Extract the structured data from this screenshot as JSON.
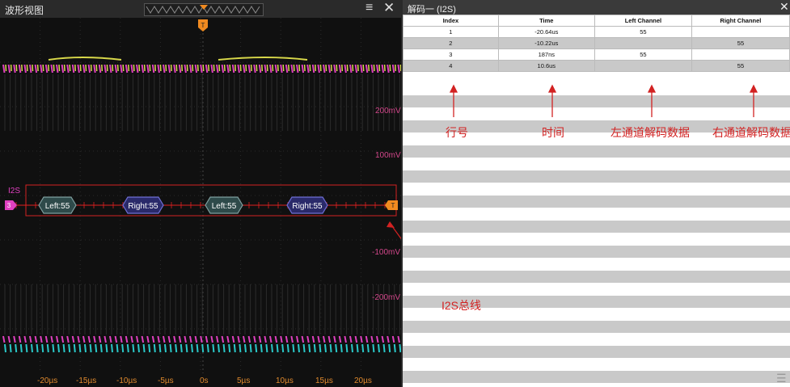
{
  "waveform": {
    "title": "波形视图",
    "trigger_marker": "T",
    "bus_label": "I2S",
    "channel_marker": "3",
    "bus_end_marker": "T",
    "packets": [
      "Left:55",
      "Right:55",
      "Left:55",
      "Right:55"
    ],
    "y_labels": [
      "200mV",
      "100mV",
      "-100mV",
      "-200mV"
    ],
    "x_labels": [
      "-20µs",
      "-15µs",
      "-10µs",
      "-5µs",
      "0s",
      "5µs",
      "10µs",
      "15µs",
      "20µs"
    ],
    "colors": {
      "trace_magenta": "#e040c0",
      "trace_yellow": "#d8d84a",
      "trace_teal": "#2ac8c8",
      "bus": "#e02020",
      "trigger": "#f08a20"
    }
  },
  "decode": {
    "title": "解码一 (I2S)",
    "columns": [
      "Index",
      "Time",
      "Left Channel",
      "Right Channel"
    ],
    "rows": [
      [
        "1",
        "-20.64us",
        "55",
        ""
      ],
      [
        "2",
        "-10.22us",
        "",
        "55"
      ],
      [
        "3",
        "187ns",
        "55",
        ""
      ],
      [
        "4",
        "10.6us",
        "",
        "55"
      ]
    ]
  },
  "annotations": {
    "row_no": "行号",
    "time": "时间",
    "left_data": "左通道解码数据",
    "right_data": "右通道解码数据",
    "bus": "I2S总线"
  },
  "icons": {
    "menu": "hamburger-icon",
    "close": "close-icon",
    "list": "list-icon"
  }
}
